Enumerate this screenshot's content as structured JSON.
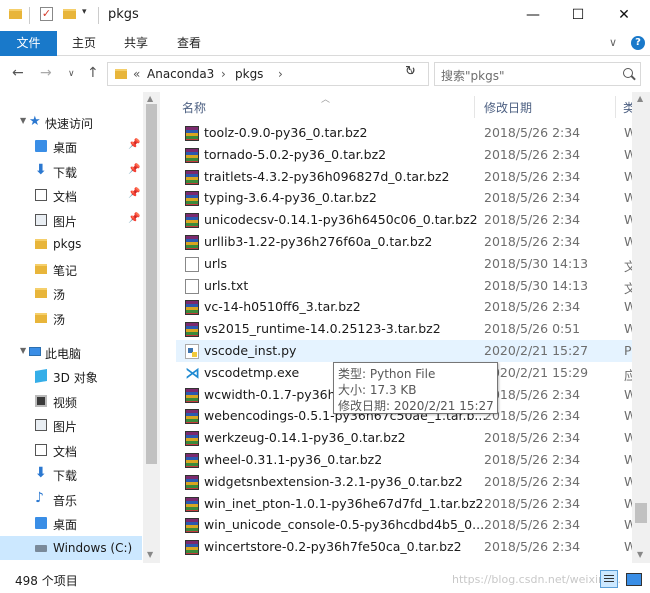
{
  "window": {
    "title": "pkgs",
    "quick_access_toolbar_arrow": "▾",
    "minimize": "—",
    "maximize": "☐",
    "close": "✕"
  },
  "ribbon": {
    "file_tab": "文件",
    "tabs": [
      "主页",
      "共享",
      "查看"
    ],
    "collapse_chevron": "∨",
    "help": "?"
  },
  "address": {
    "back": "←",
    "forward": "→",
    "recent": "∨",
    "up": "↑",
    "overflow": "«",
    "path": [
      "Anaconda3",
      "pkgs"
    ],
    "separator": "›",
    "dropdown": "∨",
    "refresh": "↻"
  },
  "search": {
    "placeholder": "搜索\"pkgs\""
  },
  "nav": {
    "quick_access": "快速访问",
    "items": [
      {
        "label": "桌面",
        "icon": "desktop-icon",
        "pinned": true
      },
      {
        "label": "下载",
        "icon": "download-icon",
        "pinned": true
      },
      {
        "label": "文档",
        "icon": "document-icon",
        "pinned": true
      },
      {
        "label": "图片",
        "icon": "picture-icon",
        "pinned": true
      },
      {
        "label": "pkgs",
        "icon": "folder-icon",
        "pinned": false
      },
      {
        "label": "笔记",
        "icon": "folder-icon",
        "pinned": false
      },
      {
        "label": "汤",
        "icon": "folder-icon",
        "pinned": false
      },
      {
        "label": "汤",
        "icon": "folder-icon",
        "pinned": false
      }
    ],
    "this_pc": "此电脑",
    "pc_items": [
      {
        "label": "3D 对象",
        "icon": "3d-objects-icon"
      },
      {
        "label": "视频",
        "icon": "video-icon"
      },
      {
        "label": "图片",
        "icon": "picture-icon"
      },
      {
        "label": "文档",
        "icon": "document-icon"
      },
      {
        "label": "下载",
        "icon": "download-icon"
      },
      {
        "label": "音乐",
        "icon": "music-icon"
      },
      {
        "label": "桌面",
        "icon": "desktop-icon"
      },
      {
        "label": "Windows (C:)",
        "icon": "drive-icon",
        "selected": true
      }
    ]
  },
  "columns": {
    "name": "名称",
    "date_modified": "修改日期",
    "type": "类"
  },
  "files": [
    {
      "name": "toolz-0.9.0-py36_0.tar.bz2",
      "date": "2018/5/26 2:34",
      "type": "W",
      "icon": "rar"
    },
    {
      "name": "tornado-5.0.2-py36_0.tar.bz2",
      "date": "2018/5/26 2:34",
      "type": "W",
      "icon": "rar"
    },
    {
      "name": "traitlets-4.3.2-py36h096827d_0.tar.bz2",
      "date": "2018/5/26 2:34",
      "type": "W",
      "icon": "rar"
    },
    {
      "name": "typing-3.6.4-py36_0.tar.bz2",
      "date": "2018/5/26 2:34",
      "type": "W",
      "icon": "rar"
    },
    {
      "name": "unicodecsv-0.14.1-py36h6450c06_0.tar.bz2",
      "date": "2018/5/26 2:34",
      "type": "W",
      "icon": "rar"
    },
    {
      "name": "urllib3-1.22-py36h276f60a_0.tar.bz2",
      "date": "2018/5/26 2:34",
      "type": "W",
      "icon": "rar"
    },
    {
      "name": "urls",
      "date": "2018/5/30 14:13",
      "type": "文",
      "icon": "txt"
    },
    {
      "name": "urls.txt",
      "date": "2018/5/30 14:13",
      "type": "文",
      "icon": "txt"
    },
    {
      "name": "vc-14-h0510ff6_3.tar.bz2",
      "date": "2018/5/26 2:34",
      "type": "W",
      "icon": "rar"
    },
    {
      "name": "vs2015_runtime-14.0.25123-3.tar.bz2",
      "date": "2018/5/26 0:51",
      "type": "W",
      "icon": "rar"
    },
    {
      "name": "vscode_inst.py",
      "date": "2020/2/21 15:27",
      "type": "Py",
      "icon": "py",
      "hover": true
    },
    {
      "name": "vscodetmp.exe",
      "date": "2020/2/21 15:29",
      "type": "应",
      "icon": "vsc"
    },
    {
      "name": "wcwidth-0.1.7-py36h3",
      "date": "2018/5/26 2:34",
      "type": "W",
      "icon": "rar"
    },
    {
      "name": "webencodings-0.5.1-py36h67c50ae_1.tar.b...",
      "date": "2018/5/26 2:34",
      "type": "W",
      "icon": "rar"
    },
    {
      "name": "werkzeug-0.14.1-py36_0.tar.bz2",
      "date": "2018/5/26 2:34",
      "type": "W",
      "icon": "rar"
    },
    {
      "name": "wheel-0.31.1-py36_0.tar.bz2",
      "date": "2018/5/26 2:34",
      "type": "W",
      "icon": "rar"
    },
    {
      "name": "widgetsnbextension-3.2.1-py36_0.tar.bz2",
      "date": "2018/5/26 2:34",
      "type": "W",
      "icon": "rar"
    },
    {
      "name": "win_inet_pton-1.0.1-py36he67d7fd_1.tar.bz2",
      "date": "2018/5/26 2:34",
      "type": "W",
      "icon": "rar"
    },
    {
      "name": "win_unicode_console-0.5-py36hcdbd4b5_0...",
      "date": "2018/5/26 2:34",
      "type": "W",
      "icon": "rar"
    },
    {
      "name": "wincertstore-0.2-py36h7fe50ca_0.tar.bz2",
      "date": "2018/5/26 2:34",
      "type": "W",
      "icon": "rar"
    }
  ],
  "tooltip": {
    "type": "类型: Python File",
    "size": "大小: 17.3 KB",
    "modified": "修改日期: 2020/2/21 15:27"
  },
  "status": {
    "item_count": "498 个项目",
    "watermark": "https://blog.csdn.net/weixin_..."
  },
  "colors": {
    "accent": "#1979ca",
    "selected_bg": "#cce8ff",
    "hover_bg": "#e5f3ff",
    "folder": "#e8b53a"
  }
}
